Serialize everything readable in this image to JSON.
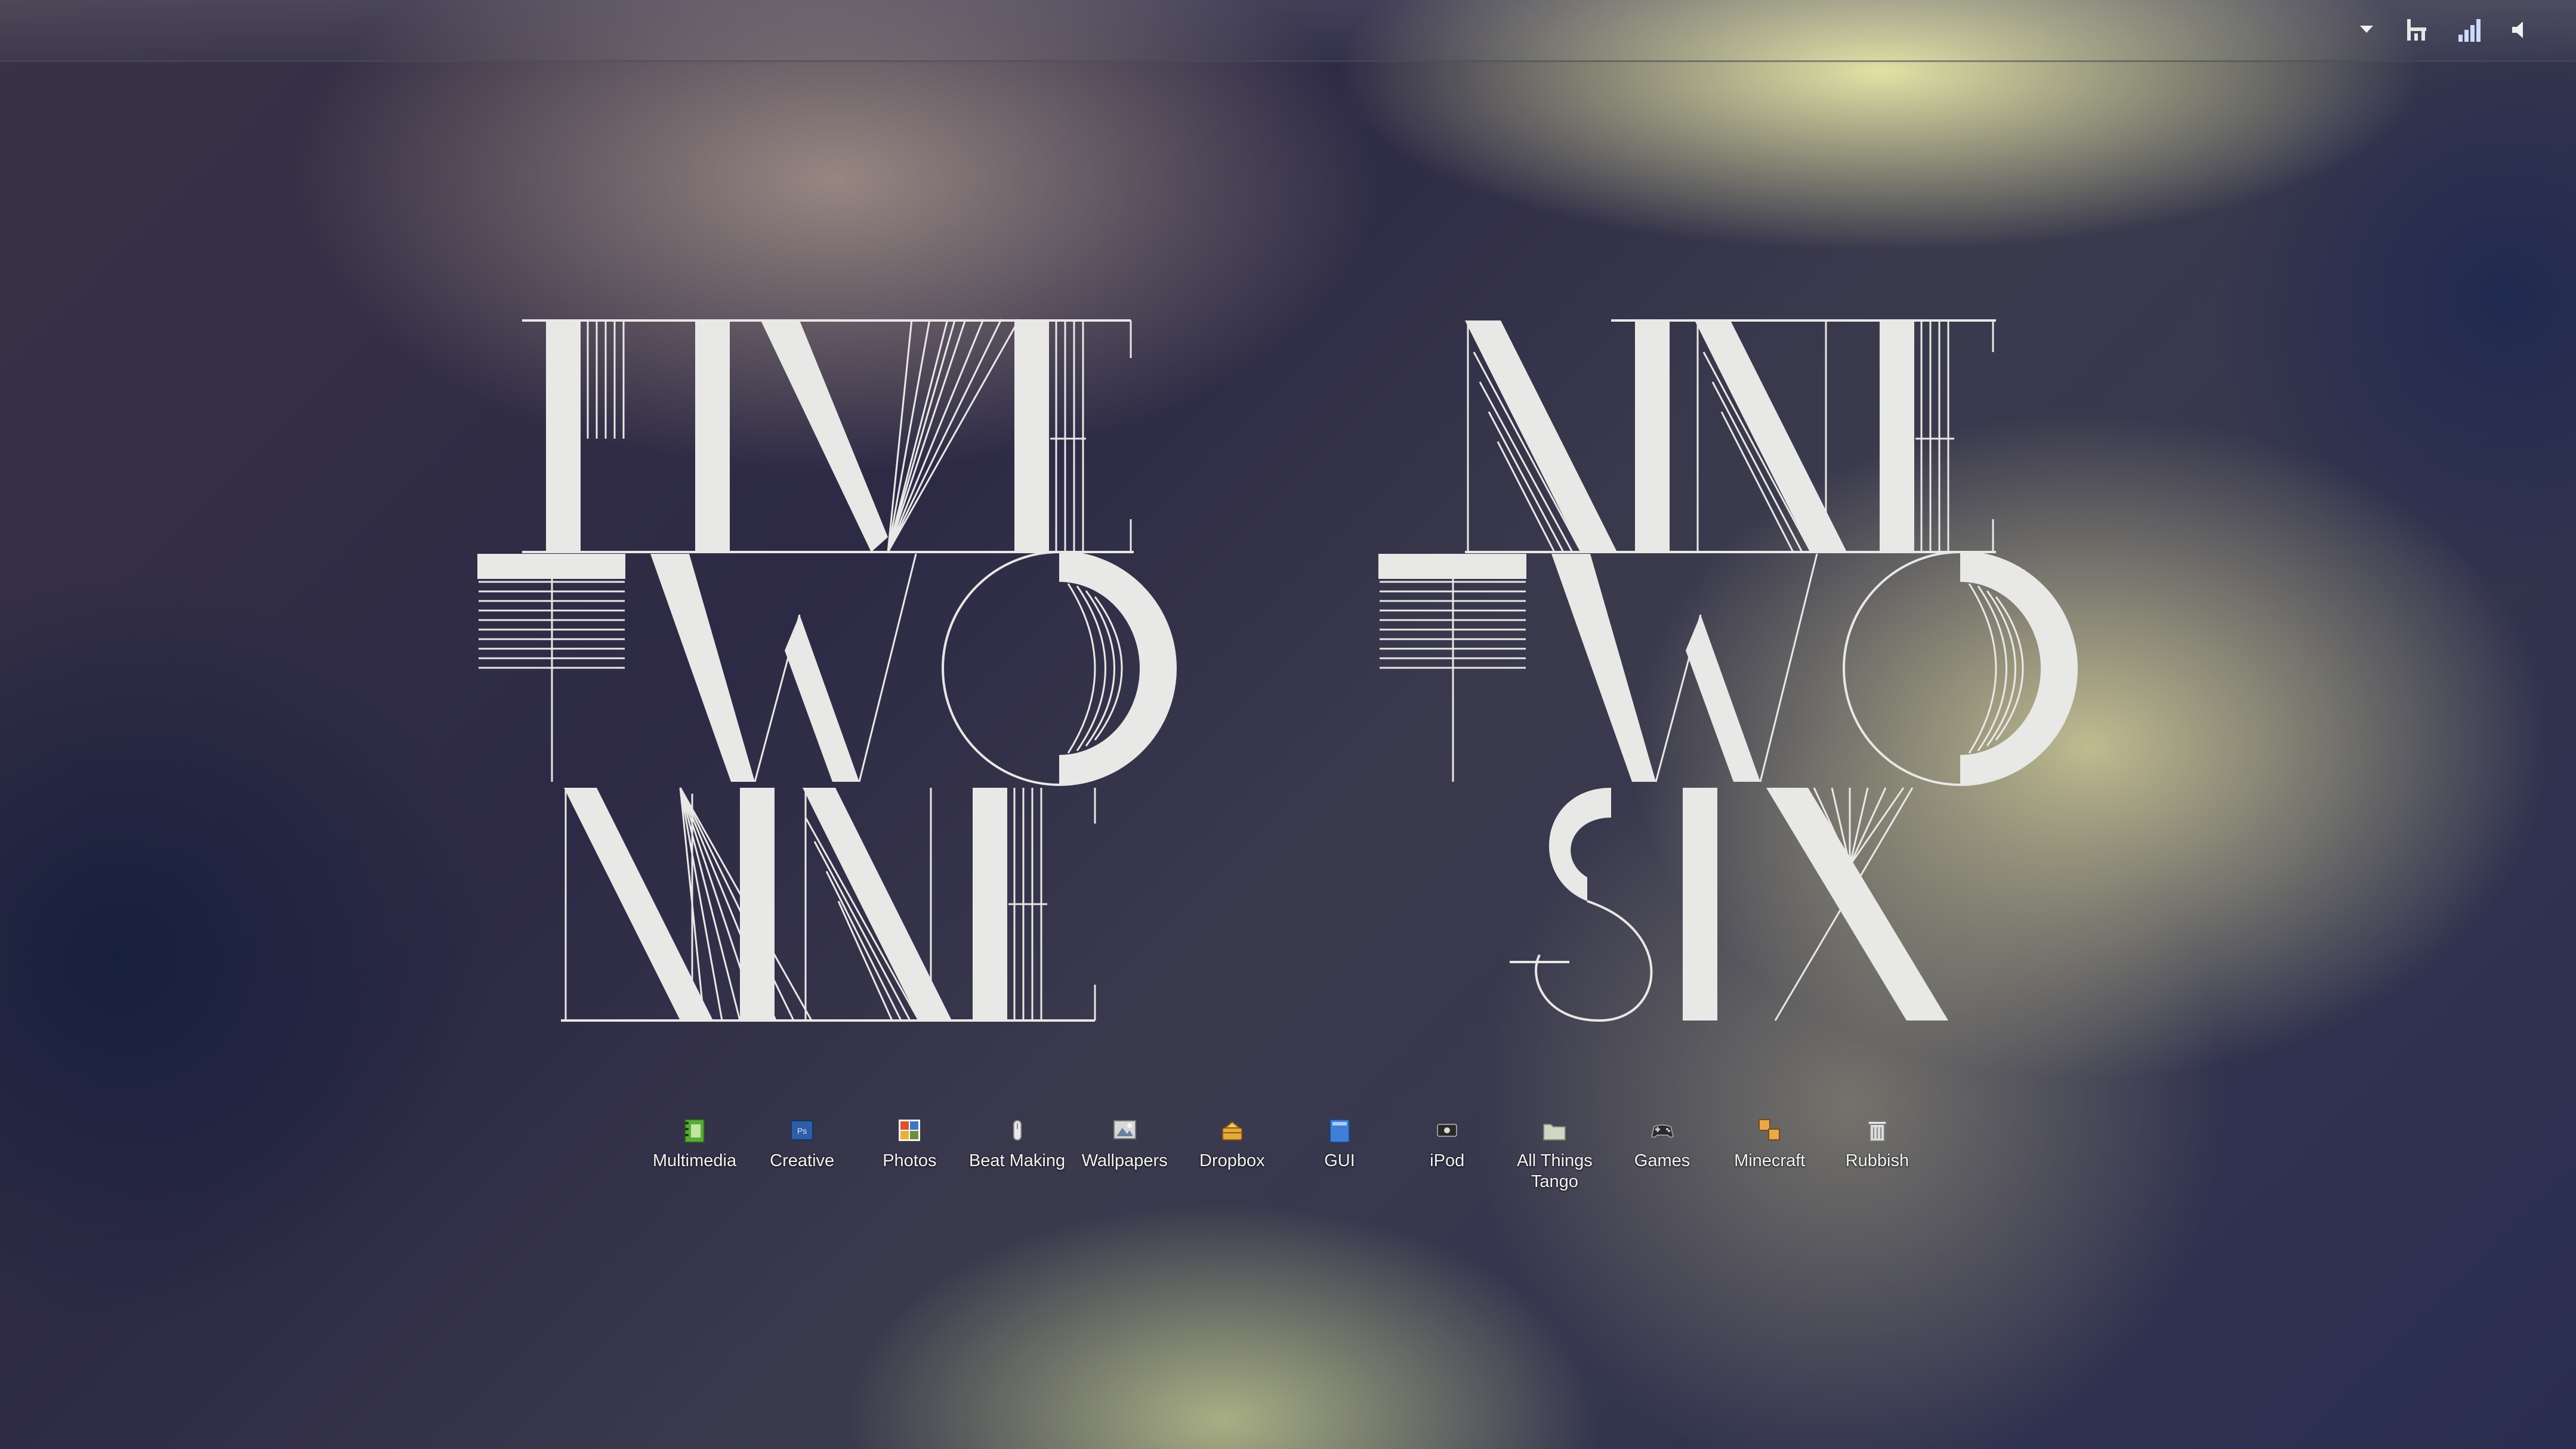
{
  "taskbar": {
    "tray_icons": [
      "overflow-chevron-icon",
      "network-icon",
      "signal-bars-icon",
      "volume-icon"
    ]
  },
  "wallpaper": {
    "left_block": [
      "FIVE",
      "TWO",
      "NINE"
    ],
    "right_block": [
      "NINE",
      "TWO",
      "SIX"
    ],
    "letter_color": "#e8e8e6"
  },
  "desktop": {
    "icons": [
      {
        "label": "Multimedia",
        "icon": "multimedia-folder-icon"
      },
      {
        "label": "Creative",
        "icon": "creative-folder-icon"
      },
      {
        "label": "Photos",
        "icon": "photos-folder-icon"
      },
      {
        "label": "Beat Making",
        "icon": "beat-making-folder-icon"
      },
      {
        "label": "Wallpapers",
        "icon": "wallpapers-folder-icon"
      },
      {
        "label": "Dropbox",
        "icon": "dropbox-icon"
      },
      {
        "label": "GUI",
        "icon": "gui-folder-icon"
      },
      {
        "label": "iPod",
        "icon": "ipod-icon"
      },
      {
        "label": "All Things Tango",
        "icon": "all-things-tango-folder-icon"
      },
      {
        "label": "Games",
        "icon": "gamepad-icon"
      },
      {
        "label": "Minecraft",
        "icon": "minecraft-folder-icon"
      },
      {
        "label": "Rubbish",
        "icon": "recycle-bin-icon"
      }
    ]
  }
}
